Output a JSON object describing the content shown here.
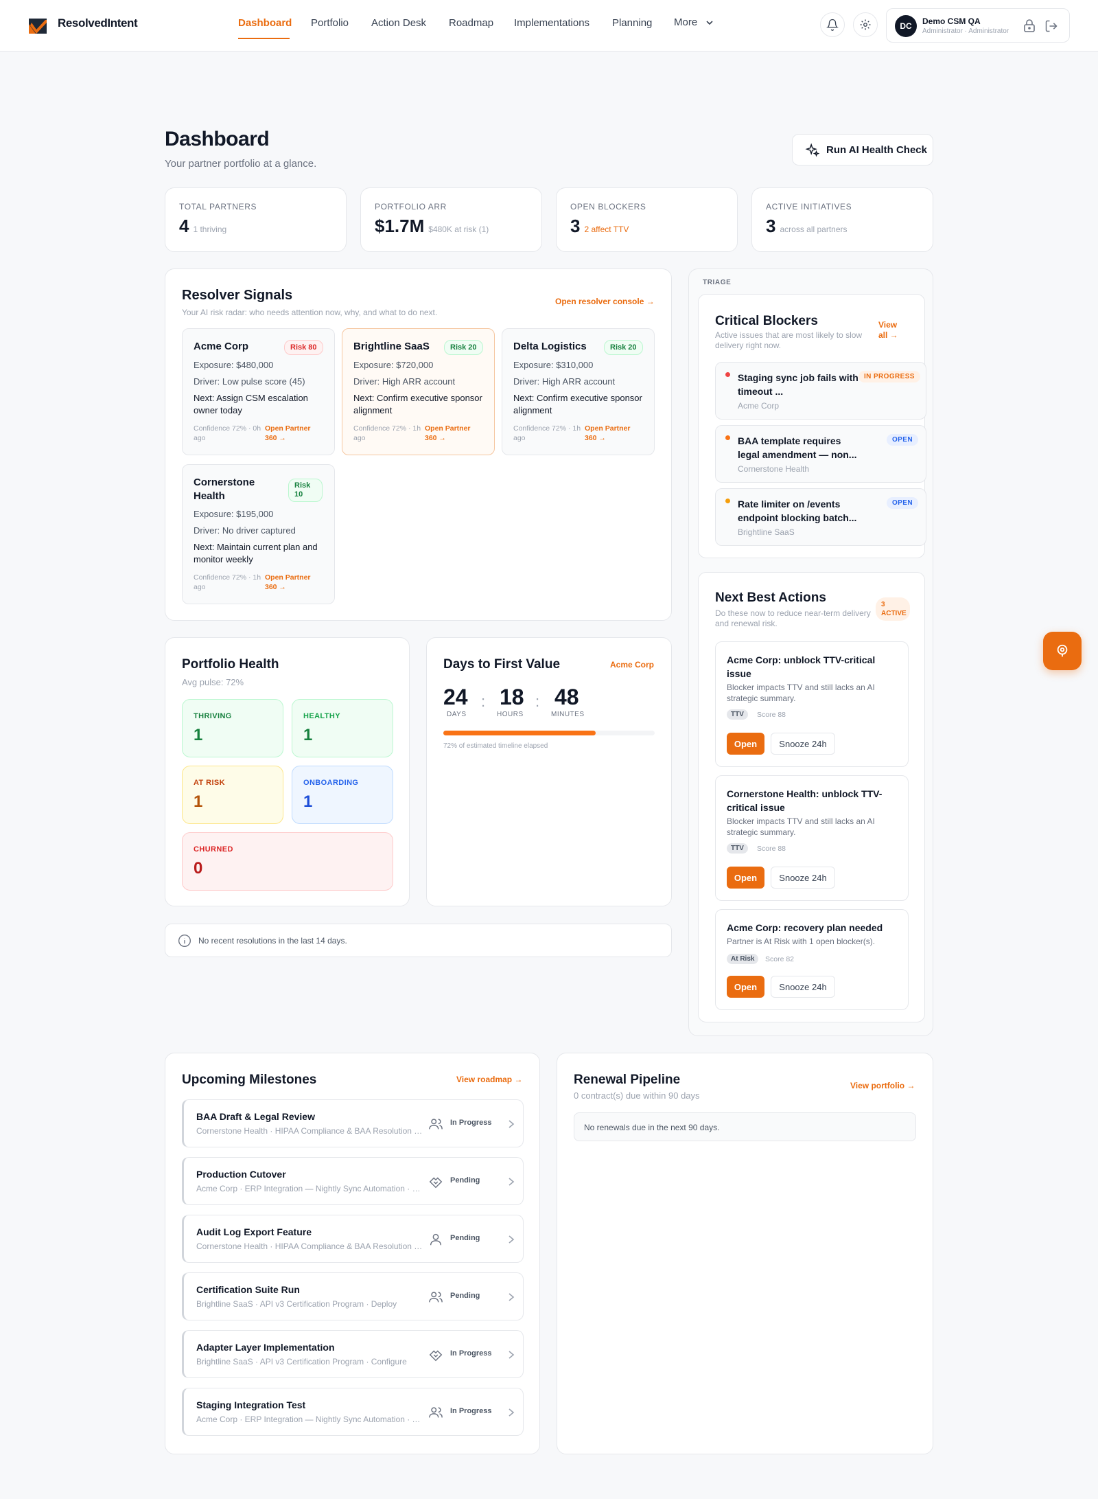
{
  "header": {
    "brand": "ResolvedIntent",
    "nav": [
      "Dashboard",
      "Portfolio",
      "Action Desk",
      "Roadmap",
      "Implementations",
      "Planning",
      "More"
    ],
    "user": {
      "initials": "DC",
      "name": "Demo CSM QA",
      "role": "Administrator · Administrator"
    }
  },
  "page": {
    "title": "Dashboard",
    "subtitle": "Your partner portfolio at a glance.",
    "ai_button": "Run AI Health Check"
  },
  "stats": [
    {
      "label": "TOTAL PARTNERS",
      "value": "4",
      "note": "1 thriving",
      "note_color": "#9ca3af"
    },
    {
      "label": "PORTFOLIO ARR",
      "value": "$1.7M",
      "note": "$480K at risk (1)",
      "note_color": "#9ca3af"
    },
    {
      "label": "OPEN BLOCKERS",
      "value": "3",
      "note": "2 affect TTV",
      "note_color": "#ea6c10"
    },
    {
      "label": "ACTIVE INITIATIVES",
      "value": "3",
      "note": "across all partners",
      "note_color": "#9ca3af"
    }
  ],
  "signals": {
    "title": "Resolver Signals",
    "subtitle": "Your AI risk radar: who needs attention now, why, and what to do next.",
    "console_link": "Open resolver console →",
    "cards": [
      {
        "name": "Acme Corp",
        "risk": "Risk 80",
        "exposure": "Exposure: $480,000",
        "driver": "Driver: Low pulse score (45)",
        "next": "Next: Assign CSM escalation owner today",
        "conf": "Confidence 72% · 0h ago",
        "open": "Open Partner 360 →"
      },
      {
        "name": "Brightline SaaS",
        "risk": "Risk 20",
        "exposure": "Exposure: $720,000",
        "driver": "Driver: High ARR account",
        "next": "Next: Confirm executive sponsor alignment",
        "conf": "Confidence 72% · 1h ago",
        "open": "Open Partner 360 →"
      },
      {
        "name": "Delta Logistics",
        "risk": "Risk 20",
        "exposure": "Exposure: $310,000",
        "driver": "Driver: High ARR account",
        "next": "Next: Confirm executive sponsor alignment",
        "conf": "Confidence 72% · 1h ago",
        "open": "Open Partner 360 →"
      },
      {
        "name": "Cornerstone Health",
        "risk": "Risk 10",
        "exposure": "Exposure: $195,000",
        "driver": "Driver: No driver captured",
        "next": "Next: Maintain current plan and monitor weekly",
        "conf": "Confidence 72% · 1h ago",
        "open": "Open Partner 360 →"
      }
    ]
  },
  "health": {
    "title": "Portfolio Health",
    "avg": "Avg pulse: 72%",
    "buckets": [
      {
        "label": "THRIVING",
        "value": "1"
      },
      {
        "label": "HEALTHY",
        "value": "1"
      },
      {
        "label": "AT RISK",
        "value": "1"
      },
      {
        "label": "ONBOARDING",
        "value": "1"
      },
      {
        "label": "CHURNED",
        "value": "0"
      }
    ]
  },
  "ttv": {
    "title": "Days to First Value",
    "partner": "Acme Corp",
    "days": "24",
    "hours": "18",
    "minutes": "48",
    "days_label": "DAYS",
    "hours_label": "HOURS",
    "minutes_label": "MINUTES",
    "progress": 0.72,
    "caption": "72% of estimated timeline elapsed"
  },
  "resolutions_note": "No recent resolutions in the last 14 days.",
  "triage": {
    "label": "TRIAGE",
    "blockers_title": "Critical Blockers",
    "blockers_sub": "Active issues that are most likely to slow delivery right now.",
    "view_all": "View all →",
    "blockers": [
      {
        "title": "Staging sync job fails with timeout ...",
        "company": "Acme Corp",
        "status": "IN PROGRESS",
        "dot": "#ef4444"
      },
      {
        "title": "BAA template requires legal amendment — non...",
        "company": "Cornerstone Health",
        "status": "OPEN",
        "dot": "#f97316"
      },
      {
        "title": "Rate limiter on /events endpoint blocking batch...",
        "company": "Brightline SaaS",
        "status": "OPEN",
        "dot": "#f59e0b"
      }
    ],
    "nba_title": "Next Best Actions",
    "nba_sub": "Do these now to reduce near-term delivery and renewal risk.",
    "nba_count": "3 ACTIVE",
    "actions": [
      {
        "title": "Acme Corp: unblock TTV-critical issue",
        "desc": "Blocker impacts TTV and still lacks an AI strategic summary.",
        "tag": "TTV",
        "score": "Score 88",
        "open": "Open",
        "snooze": "Snooze 24h"
      },
      {
        "title": "Cornerstone Health: unblock TTV-critical issue",
        "desc": "Blocker impacts TTV and still lacks an AI strategic summary.",
        "tag": "TTV",
        "score": "Score 88",
        "open": "Open",
        "snooze": "Snooze 24h"
      },
      {
        "title": "Acme Corp: recovery plan needed",
        "desc": "Partner is At Risk with 1 open blocker(s).",
        "tag": "At Risk",
        "score": "Score 82",
        "open": "Open",
        "snooze": "Snooze 24h"
      }
    ]
  },
  "milestones": {
    "title": "Upcoming Milestones",
    "link": "View roadmap →",
    "items": [
      {
        "title": "BAA Draft & Legal Review",
        "sub": "Cornerstone Health · HIPAA Compliance & BAA Resolution · Legal",
        "status": "In Progress",
        "icon": "users-icon"
      },
      {
        "title": "Production Cutover",
        "sub": "Acme Corp · ERP Integration — Nightly Sync Automation · Launch",
        "status": "Pending",
        "icon": "handshake-icon"
      },
      {
        "title": "Audit Log Export Feature",
        "sub": "Cornerstone Health · HIPAA Compliance & BAA Resolution · Build",
        "status": "Pending",
        "icon": "user-icon"
      },
      {
        "title": "Certification Suite Run",
        "sub": "Brightline SaaS · API v3 Certification Program · Deploy",
        "status": "Pending",
        "icon": "users-icon"
      },
      {
        "title": "Adapter Layer Implementation",
        "sub": "Brightline SaaS · API v3 Certification Program · Configure",
        "status": "In Progress",
        "icon": "handshake-icon"
      },
      {
        "title": "Staging Integration Test",
        "sub": "Acme Corp · ERP Integration — Nightly Sync Automation · Test",
        "status": "In Progress",
        "icon": "users-icon"
      }
    ]
  },
  "renewal": {
    "title": "Renewal Pipeline",
    "sub": "0 contract(s) due within 90 days",
    "link": "View portfolio →",
    "empty": "No renewals due in the next 90 days."
  }
}
